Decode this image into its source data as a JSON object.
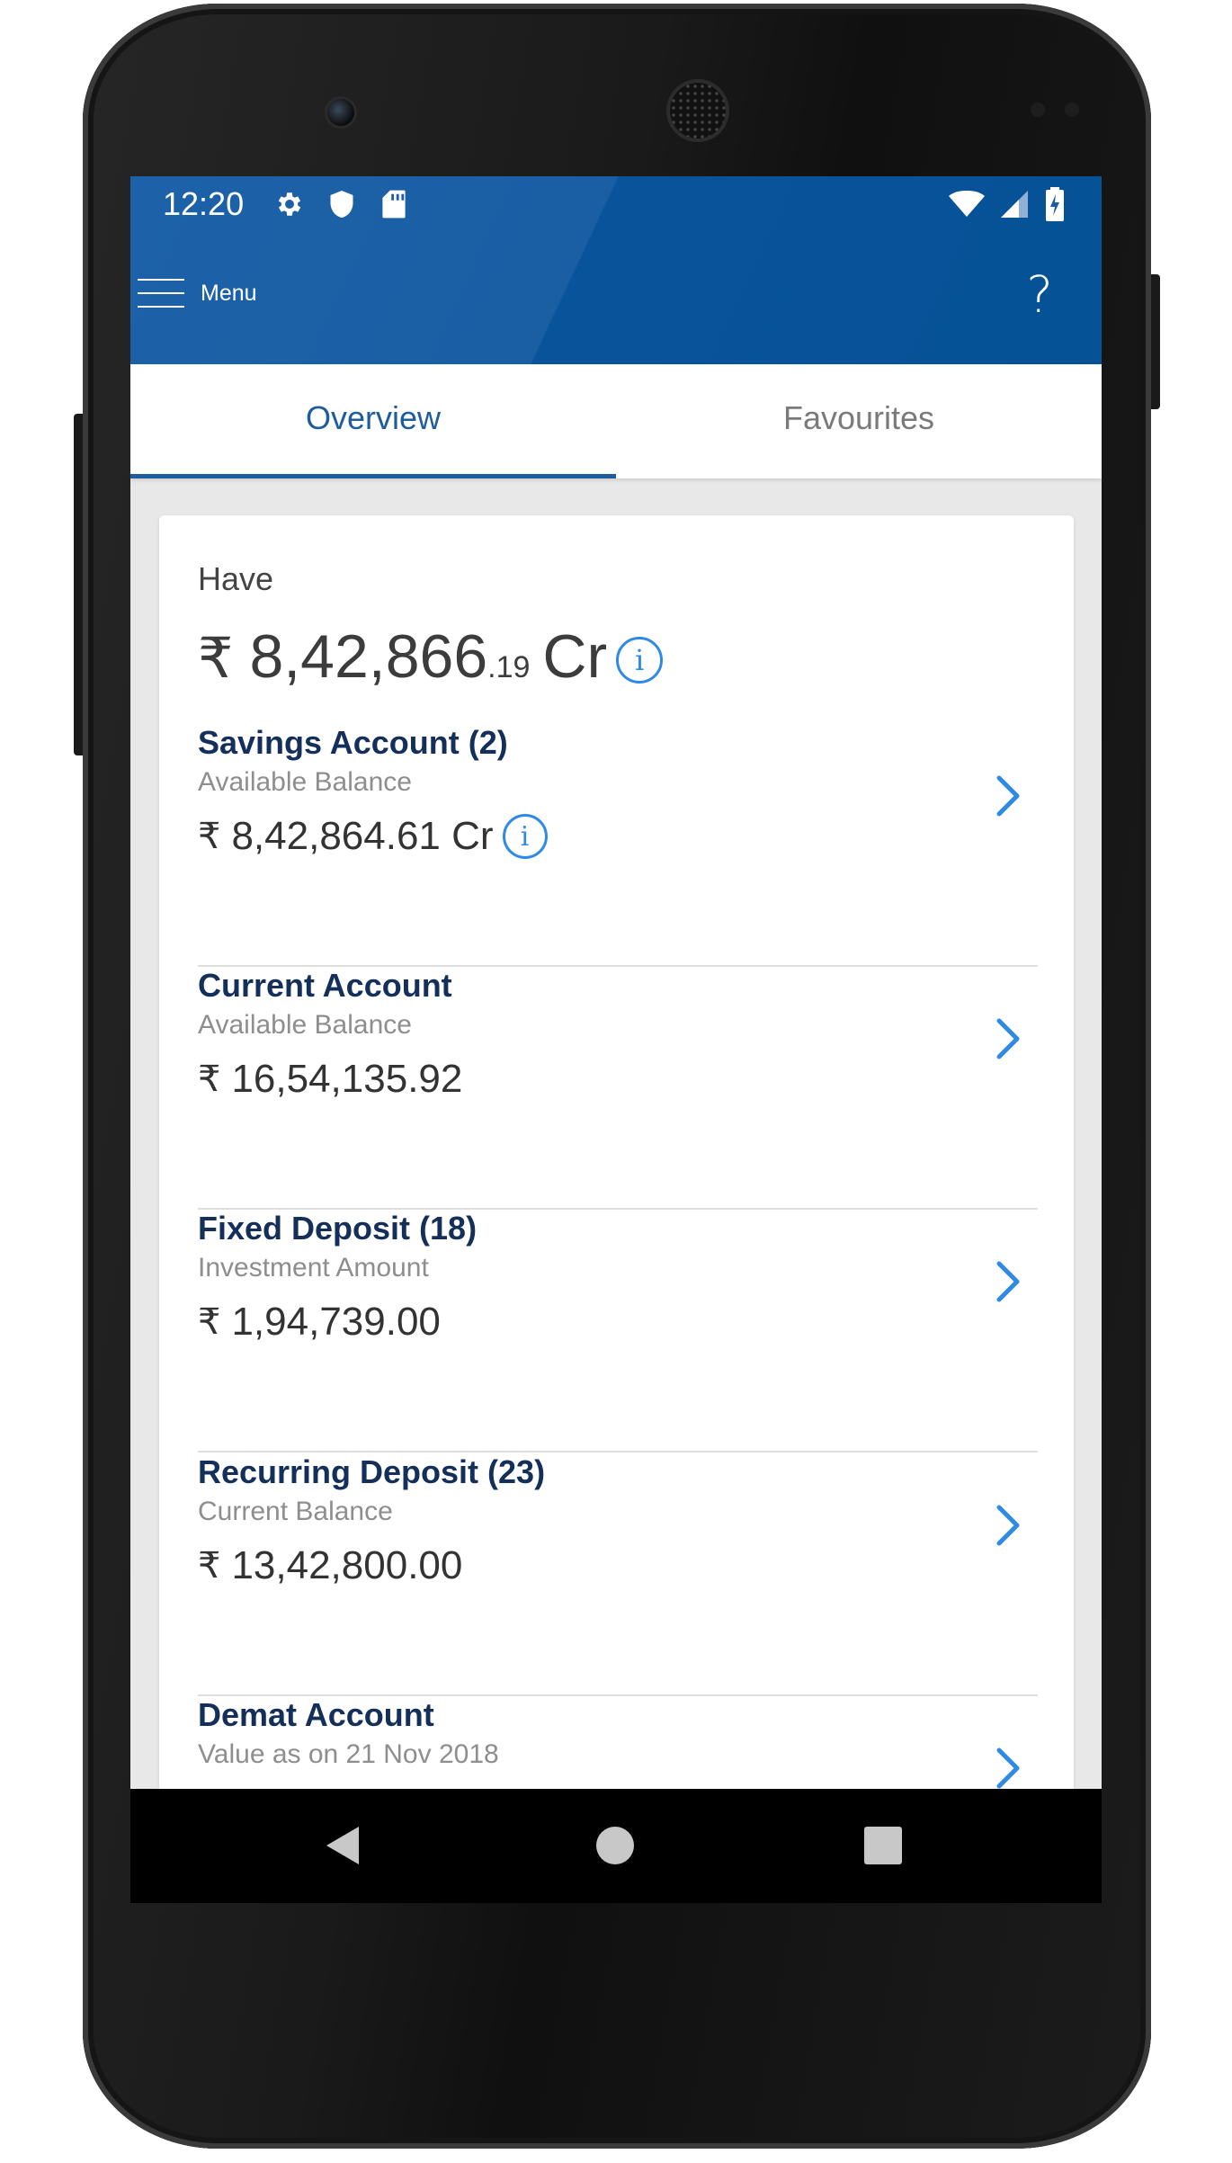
{
  "status_bar": {
    "time": "12:20",
    "left_icons": [
      "gear-icon",
      "shield-icon",
      "sd-card-icon"
    ],
    "right_icons": [
      "wifi-icon",
      "signal-icon",
      "battery-charging-icon"
    ]
  },
  "app_bar": {
    "menu_label": "Menu",
    "help_label": "?"
  },
  "tabs": [
    {
      "label": "Overview",
      "active": true
    },
    {
      "label": "Favourites",
      "active": false
    }
  ],
  "summary": {
    "label": "Have",
    "currency_symbol": "₹",
    "total_whole": "8,42,866",
    "total_decimal": ".19",
    "total_unit": "Cr",
    "info_glyph": "i"
  },
  "accounts": [
    {
      "title": "Savings Account (2)",
      "subtitle": "Available Balance",
      "currency": "₹",
      "amount": "8,42,864.61 Cr",
      "has_info": true
    },
    {
      "title": "Current Account",
      "subtitle": "Available Balance",
      "currency": "₹",
      "amount": "16,54,135.92",
      "has_info": false
    },
    {
      "title": "Fixed Deposit (18)",
      "subtitle": "Investment Amount",
      "currency": "₹",
      "amount": "1,94,739.00",
      "has_info": false
    },
    {
      "title": "Recurring Deposit (23)",
      "subtitle": "Current Balance",
      "currency": "₹",
      "amount": "13,42,800.00",
      "has_info": false
    },
    {
      "title": "Demat Account",
      "subtitle": "Value as on 21 Nov 2018",
      "currency": "",
      "amount": "",
      "has_info": false
    }
  ],
  "colors": {
    "brand_blue": "#1d5d9e",
    "accent_blue": "#2f8ae4",
    "title_navy": "#132f5a"
  },
  "nav_bar": [
    "back-icon",
    "home-icon",
    "recent-apps-icon"
  ]
}
